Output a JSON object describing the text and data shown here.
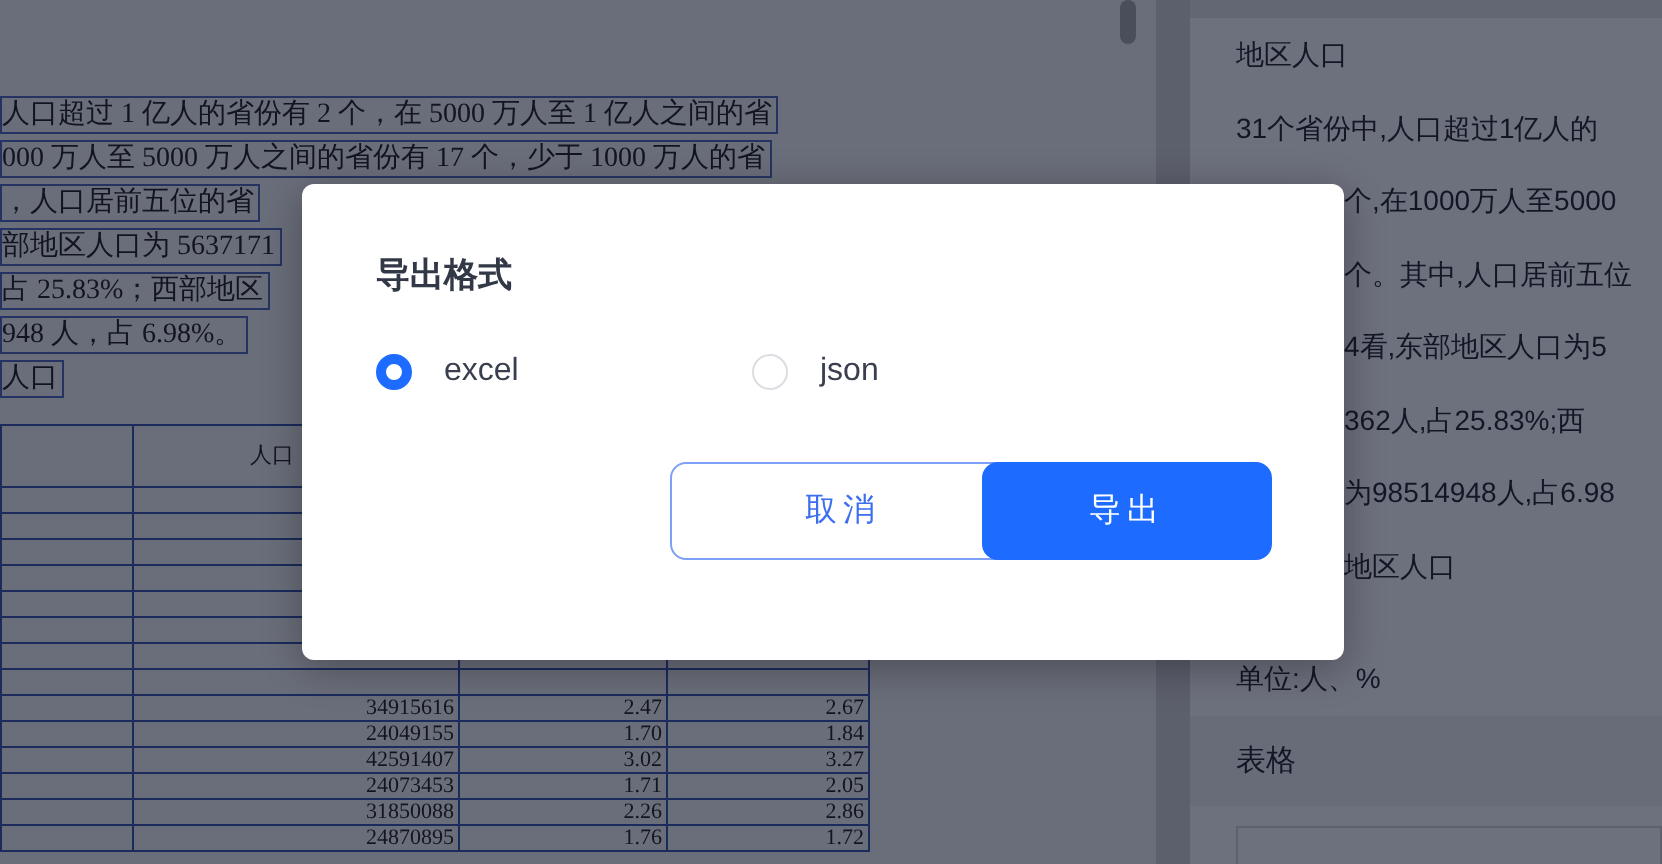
{
  "document": {
    "lines": [
      "人口超过 1 亿人的省份有 2 个，在 5000 万人至 1 亿人之间的省",
      "000 万人至 5000 万人之间的省份有 17 个，少于 1000 万人的省",
      "，人口居前五位的省",
      "部地区人口为 5637171",
      "占 25.83%；西部地区",
      "948 人，占 6.98%。",
      "人口"
    ],
    "table": {
      "header": "人口",
      "rows": [
        [
          "34915616",
          "2.47",
          "2.67"
        ],
        [
          "24049155",
          "1.70",
          "1.84"
        ],
        [
          "42591407",
          "3.02",
          "3.27"
        ],
        [
          "24073453",
          "1.71",
          "2.05"
        ],
        [
          "31850088",
          "2.26",
          "2.86"
        ],
        [
          "24870895",
          "1.76",
          "1.72"
        ]
      ]
    }
  },
  "side_panel": {
    "heading": "地区人口",
    "lines": [
      {
        "text": "31个省份中,人口超过1亿人的",
        "kind": "full"
      },
      {
        "text": "个,在1000万人至5000",
        "kind": "partial"
      },
      {
        "text": "个。其中,人口居前五位",
        "kind": "partial"
      },
      {
        "text": "4看,东部地区人口为5",
        "kind": "partial"
      },
      {
        "text": "362人,占25.83%;西",
        "kind": "partial"
      },
      {
        "text": "为98514948人,占6.98",
        "kind": "partial"
      },
      {
        "text": "地区人口",
        "kind": "partial"
      },
      {
        "text": "单位:人、%",
        "kind": "note"
      }
    ],
    "section_title": "表格"
  },
  "dialog": {
    "title": "导出格式",
    "options": [
      {
        "label": "excel",
        "selected": true
      },
      {
        "label": "json",
        "selected": false
      }
    ],
    "buttons": [
      {
        "label": "取消",
        "kind": "secondary"
      },
      {
        "label": "导出",
        "kind": "primary"
      }
    ]
  }
}
